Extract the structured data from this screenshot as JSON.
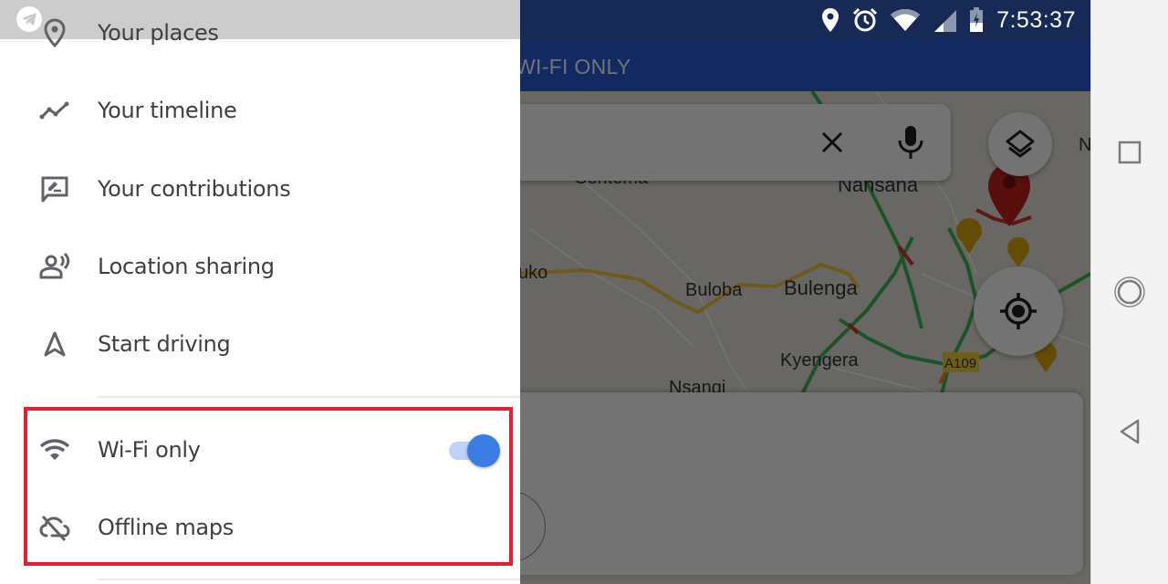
{
  "status_bar": {
    "time": "7:53:37",
    "icons": [
      "location-icon",
      "alarm-icon",
      "wifi-signal-icon",
      "cell-signal-icon",
      "battery-charging-icon"
    ]
  },
  "app_bar": {
    "title": "WI-FI ONLY"
  },
  "map": {
    "labels": [
      {
        "text": "Sentema"
      },
      {
        "text": "Nansana"
      },
      {
        "text": "uko"
      },
      {
        "text": "Buloba"
      },
      {
        "text": "Bulenga"
      },
      {
        "text": "Kyengera"
      },
      {
        "text": "Nsangi"
      },
      {
        "text": "N"
      }
    ],
    "road_badge": "A109",
    "colors": {
      "traffic_green": "#3cba54",
      "traffic_orange": "#f28b30",
      "traffic_red": "#d8332b",
      "road_yellow": "#f4c542",
      "pin_red": "#c5221f",
      "poi_gold": "#e0a80d"
    }
  },
  "search": {
    "clear_icon": "close-icon",
    "mic_icon": "mic-icon"
  },
  "drawer": {
    "items": [
      {
        "label": "Your places",
        "icon": "place-pin-icon"
      },
      {
        "label": "Your timeline",
        "icon": "timeline-icon"
      },
      {
        "label": "Your contributions",
        "icon": "contributions-icon"
      },
      {
        "label": "Location sharing",
        "icon": "location-sharing-icon"
      },
      {
        "label": "Start driving",
        "icon": "navigation-arrow-icon"
      }
    ],
    "settings_items": [
      {
        "label": "Wi-Fi only",
        "icon": "wifi-icon",
        "toggle_on": true
      },
      {
        "label": "Offline maps",
        "icon": "cloud-off-icon"
      }
    ],
    "highlight_color": "#e5202e",
    "toggle_color": "#3a7ee4"
  },
  "nav_bar": {
    "buttons": [
      "recents-square-icon",
      "home-circle-icon",
      "back-triangle-icon"
    ]
  }
}
